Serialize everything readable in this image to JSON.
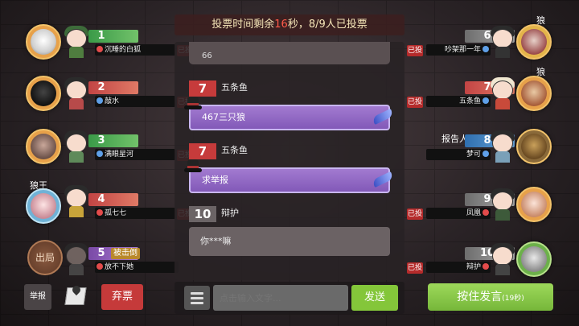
{
  "header": {
    "banner_prefix": "投票时间剩余",
    "countdown": "16",
    "banner_suffix": "秒，8/9人已投票"
  },
  "players": [
    {
      "seat": "1",
      "name": "沉睡的白狐",
      "vote": "已投",
      "color": "green",
      "dot": "red"
    },
    {
      "seat": "2",
      "name": "敲水",
      "vote": "已投",
      "color": "red",
      "dot": "blue"
    },
    {
      "seat": "3",
      "name": "满眼星河",
      "vote": "已投",
      "color": "green",
      "dot": "blue"
    },
    {
      "seat": "4",
      "name": "孤七七",
      "vote": "已投",
      "color": "red",
      "dot": "red",
      "role": "狼王"
    },
    {
      "seat": "5",
      "name": "放不下她",
      "vote": "",
      "color": "purple",
      "dot": "red",
      "status": "被击倒",
      "badge": "出局"
    },
    {
      "seat": "6",
      "name": "吵架那一年",
      "vote": "已投",
      "color": "gray",
      "dot": "blue",
      "role": "狼人"
    },
    {
      "seat": "7",
      "name": "五条鱼",
      "vote": "已投",
      "color": "red",
      "dot": "blue",
      "role": "狼人"
    },
    {
      "seat": "8",
      "name": "梦可",
      "vote": "已投",
      "color": "blue",
      "dot": "blue",
      "role": "报告人"
    },
    {
      "seat": "9",
      "name": "凤凰",
      "vote": "已投",
      "color": "gray",
      "dot": "red"
    },
    {
      "seat": "10",
      "name": "辩护",
      "vote": "已投",
      "color": "gray",
      "dot": "red"
    }
  ],
  "chat": {
    "fragment": "66",
    "messages": [
      {
        "seat": "7",
        "name": "五条鱼",
        "text": "467三只狼"
      },
      {
        "seat": "7",
        "name": "五条鱼",
        "text": "求举报"
      },
      {
        "seat": "10",
        "name": "辩护",
        "text": "你***嘛"
      }
    ]
  },
  "input": {
    "placeholder": "点击输入文字...",
    "send_label": "发送"
  },
  "controls": {
    "report_label": "举报",
    "abstain_label": "弃票",
    "speak_label": "按住发言",
    "speak_timer": "(19秒)"
  }
}
